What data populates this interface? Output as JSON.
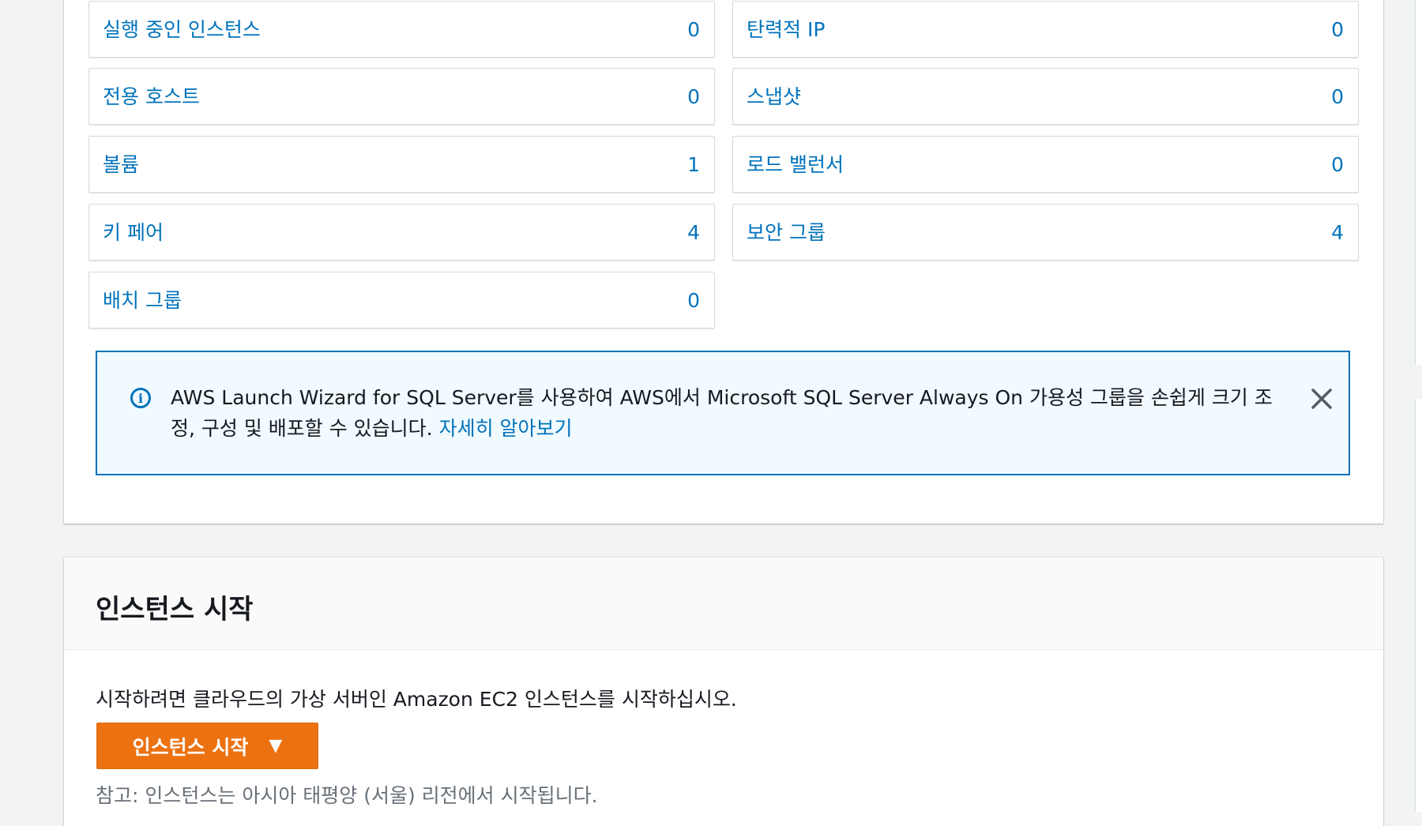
{
  "resources": {
    "left": [
      {
        "label": "실행 중인 인스턴스",
        "count": "0"
      },
      {
        "label": "전용 호스트",
        "count": "0"
      },
      {
        "label": "볼륨",
        "count": "1"
      },
      {
        "label": "키 페어",
        "count": "4"
      },
      {
        "label": "배치 그룹",
        "count": "0"
      }
    ],
    "right": [
      {
        "label": "탄력적 IP",
        "count": "0"
      },
      {
        "label": "스냅샷",
        "count": "0"
      },
      {
        "label": "로드 밸런서",
        "count": "0"
      },
      {
        "label": "보안 그룹",
        "count": "4"
      }
    ]
  },
  "info": {
    "icon": "info-circle-icon",
    "text": "AWS Launch Wizard for SQL Server를 사용하여 AWS에서 Microsoft SQL Server Always On 가용성 그룹을 손쉽게 크기 조정, 구성 및 배포할 수 있습니다.",
    "link": "자세히 알아보기",
    "close_icon": "close-icon"
  },
  "launch": {
    "title": "인스턴스 시작",
    "description": "시작하려면 클라우드의 가상 서버인 Amazon EC2 인스턴스를 시작하십시오.",
    "button_label": "인스턴스 시작",
    "button_caret": "▼",
    "note": "참고: 인스턴스는 아시아 태평양 (서울) 리전에서 시작됩니다."
  },
  "colors": {
    "link": "#0073bb",
    "info_bg": "#f1faff",
    "primary_button": "#ec7211",
    "page_bg": "#f2f3f3"
  }
}
